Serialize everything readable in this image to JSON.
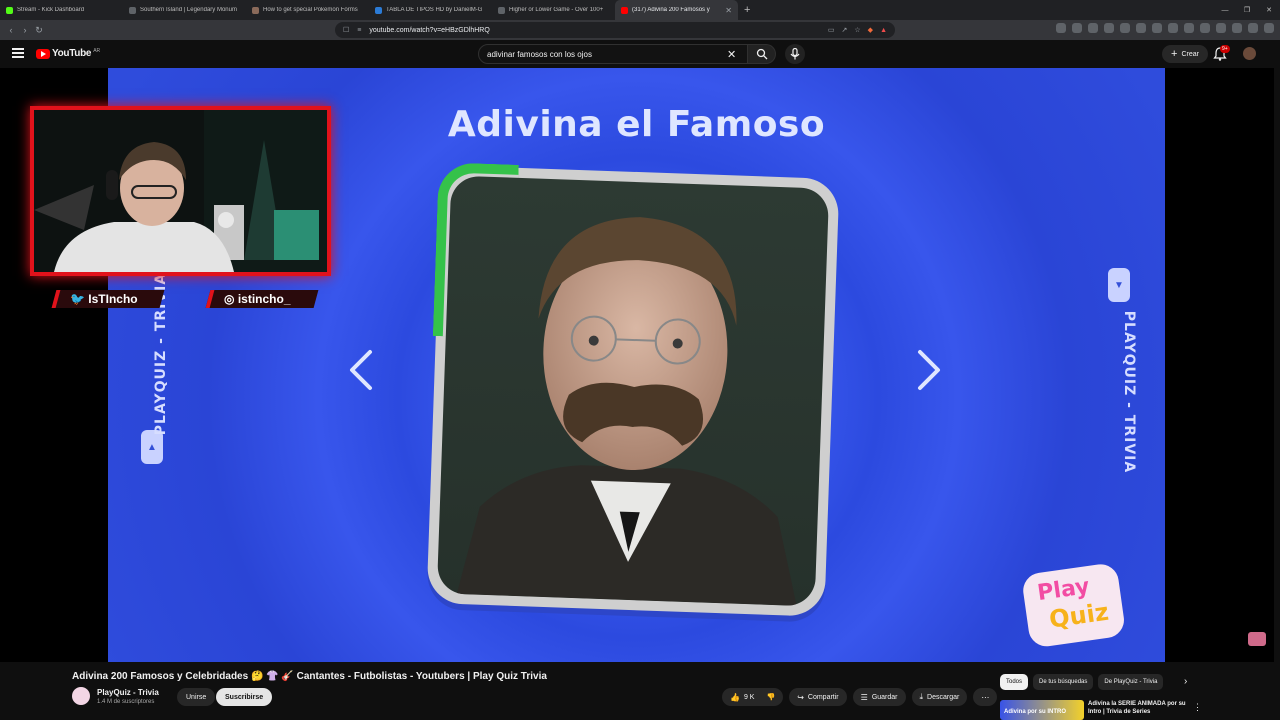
{
  "browser": {
    "tabs": [
      {
        "label": "Stream - Kick Dashboard",
        "color": "#53fc18"
      },
      {
        "label": "Southern Island | Legendary Monum",
        "color": "#5f6368"
      },
      {
        "label": "How to get special Pokemon Forms",
        "color": "#8a6a5a"
      },
      {
        "label": "TABLA DE TIPOS HD by DanielM-G",
        "color": "#2b7bd6"
      },
      {
        "label": "Higher or Lower Game - Over 100+",
        "color": "#5f6368"
      },
      {
        "label": "(317) Adivina 200 Famosos y",
        "color": "#ff0000"
      }
    ],
    "url": "youtube.com/watch?v=eHBzGDlhHRQ"
  },
  "youtube": {
    "logo_text": "YouTube",
    "region": "AR",
    "search_value": "adivinar famosos con los ojos",
    "create_label": "Crear",
    "notif_count": "9+"
  },
  "video": {
    "heading": "Adivina el Famoso",
    "side_text": "PLAYQUIZ - TRIVIA",
    "logo_play": "Play",
    "logo_quiz": "Quiz",
    "twitter_handle": "IsTIncho",
    "instagram_handle": "istincho_"
  },
  "info": {
    "title": "Adivina 200 Famosos y Celebridades 🤔 👚 🎸 Cantantes - Futbolistas - Youtubers | Play Quiz Trivia",
    "channel": "PlayQuiz - Trivia",
    "subscribers": "1.4 M de suscriptores",
    "join": "Unirse",
    "subscribe": "Suscribirse",
    "likes": "9 K",
    "share": "Compartir",
    "save": "Guardar",
    "download": "Descargar"
  },
  "sidebar": {
    "chips": [
      "Todos",
      "De tus búsquedas",
      "De PlayQuiz - Trivia"
    ],
    "rec_thumb_text": "Adivina por su INTRO",
    "rec_title": "Adivina la SERIE ANIMADA por su Intro | Trivia de Series"
  }
}
